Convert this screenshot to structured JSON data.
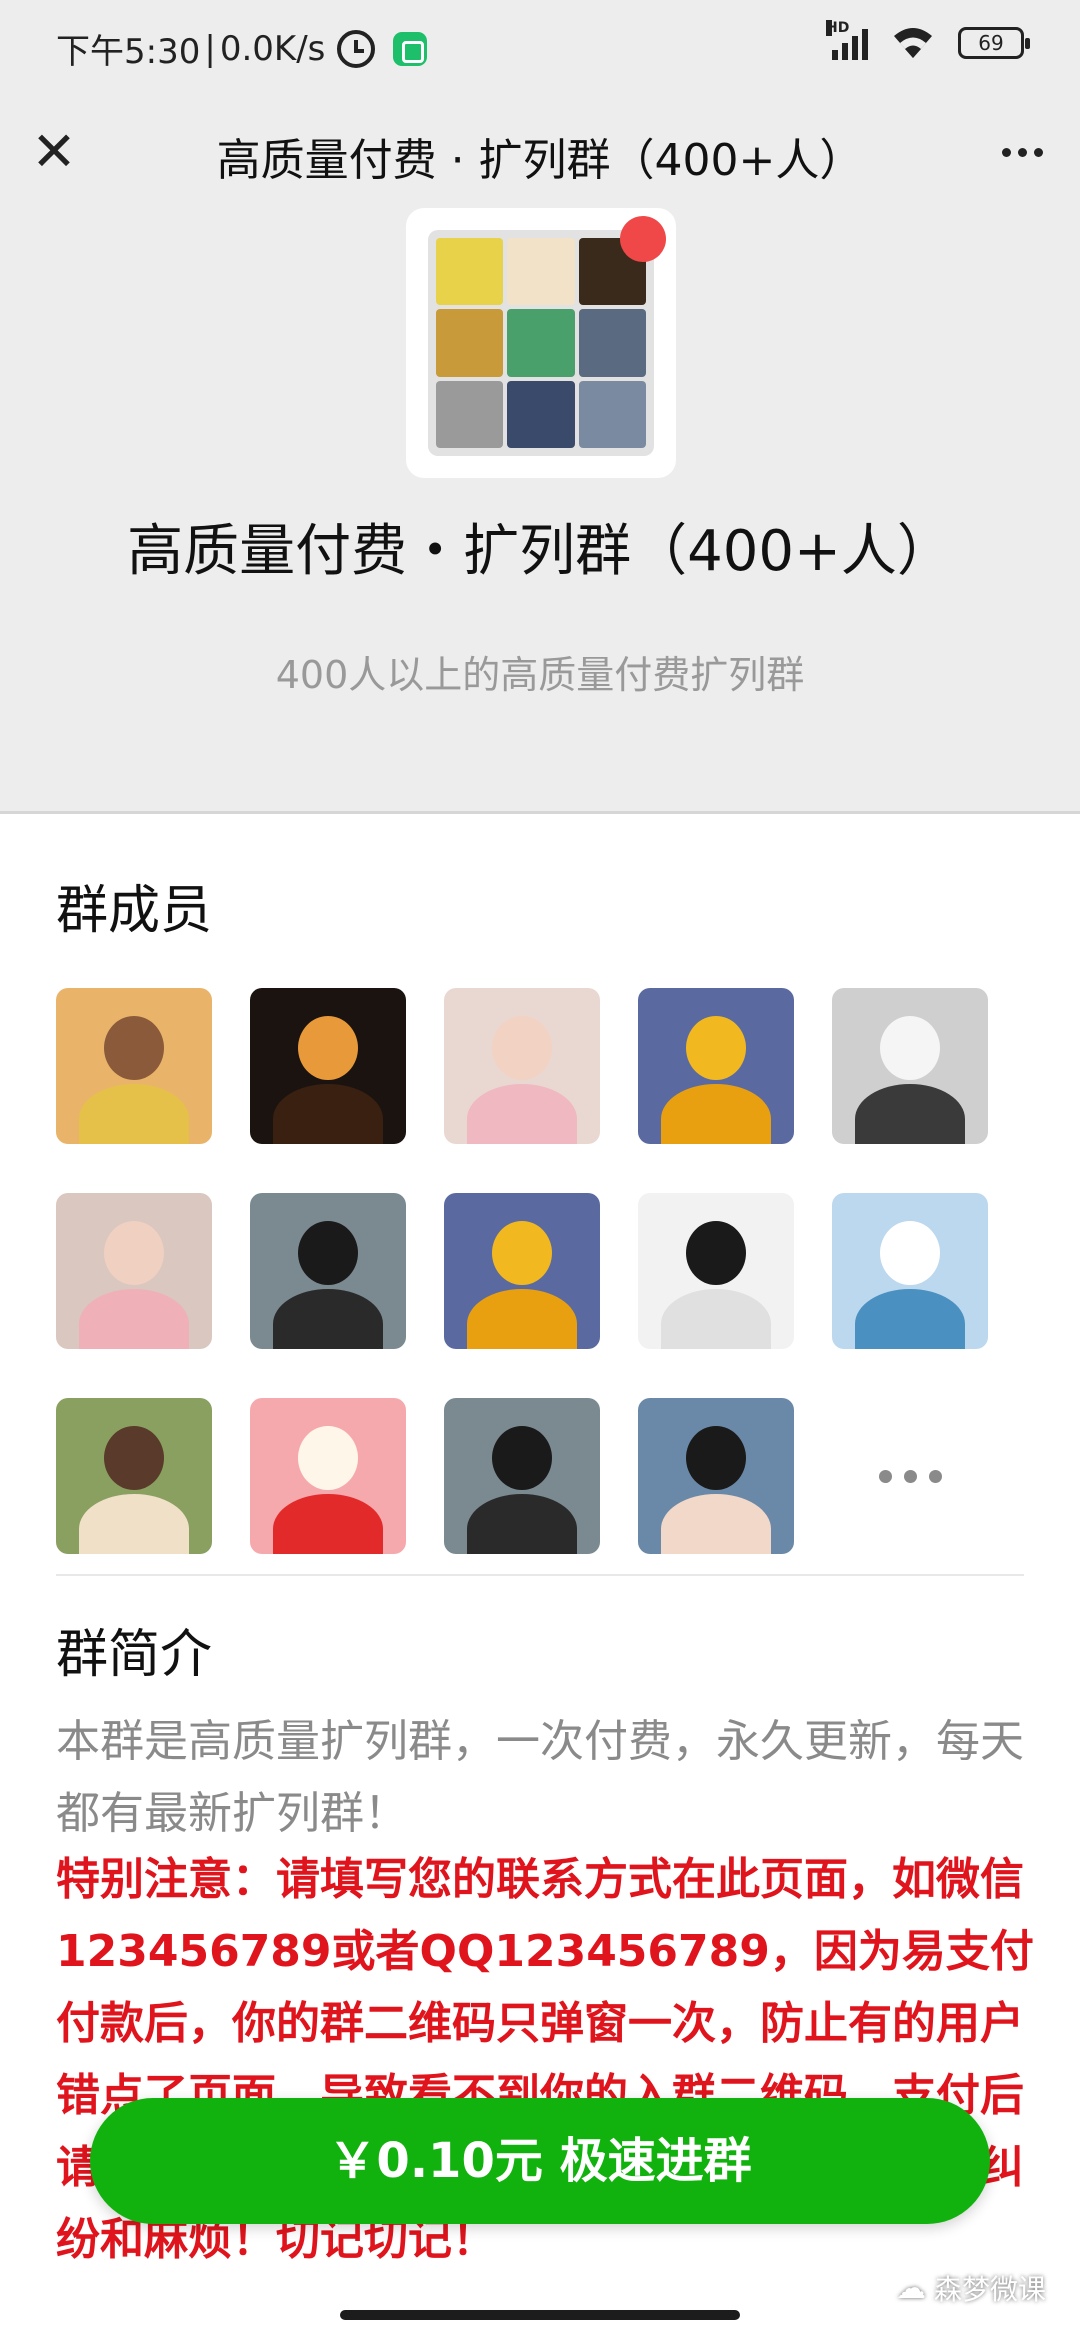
{
  "status_bar": {
    "time": "下午5:30",
    "separator": "|",
    "speed": "0.0K/s",
    "signal_label": "HD",
    "battery": "69"
  },
  "nav": {
    "title": "高质量付费 · 扩列群（400+人）",
    "close_icon": "close-icon",
    "more_icon": "more-icon"
  },
  "group": {
    "name": "高质量付费・扩列群（400+人）",
    "description": "400人以上的高质量付费扩列群",
    "avatar_colors": [
      "#e7d24a",
      "#f2e3c8",
      "#3a2a1c",
      "#c89a3a",
      "#4aa06a",
      "#5a6a80",
      "#9a9a9a",
      "#3a4a6a",
      "#7a8aa0"
    ]
  },
  "members": {
    "title": "群成员",
    "items": [
      {
        "name": "member-1",
        "bg": "#e9b46a",
        "head": "#8a5a3a",
        "body": "#e5c14a"
      },
      {
        "name": "member-2",
        "bg": "#1a1310",
        "head": "#e89a3a",
        "body": "#3a2010"
      },
      {
        "name": "member-3",
        "bg": "#e9d8d2",
        "head": "#f2d2c2",
        "body": "#f0b8c0"
      },
      {
        "name": "member-4",
        "bg": "#5a6aa0",
        "head": "#f2b820",
        "body": "#e8a010"
      },
      {
        "name": "member-5",
        "bg": "#cfcfcf",
        "head": "#f5f5f5",
        "body": "#3a3a3a"
      },
      {
        "name": "member-6",
        "bg": "#d9c7c0",
        "head": "#f0d0c0",
        "body": "#f0b0b8"
      },
      {
        "name": "member-7",
        "bg": "#7a8a90",
        "head": "#1a1a1a",
        "body": "#2a2a2a"
      },
      {
        "name": "member-8",
        "bg": "#5a6aa0",
        "head": "#f2b820",
        "body": "#e8a010"
      },
      {
        "name": "member-9",
        "bg": "#f2f2f2",
        "head": "#1a1a1a",
        "body": "#e0e0e0"
      },
      {
        "name": "member-10",
        "bg": "#bcd8ee",
        "head": "#ffffff",
        "body": "#4a90c0"
      },
      {
        "name": "member-11",
        "bg": "#8aa060",
        "head": "#5a3a2a",
        "body": "#f0e0c8"
      },
      {
        "name": "member-12",
        "bg": "#f6a9ad",
        "head": "#fff6ea",
        "body": "#e22a2a"
      },
      {
        "name": "member-13",
        "bg": "#7a8a90",
        "head": "#1a1a1a",
        "body": "#2a2a2a"
      },
      {
        "name": "member-14",
        "bg": "#6a88a8",
        "head": "#1a1a1a",
        "body": "#f2d8c8"
      }
    ],
    "more_icon": "more-dots-icon"
  },
  "intro": {
    "title": "群简介",
    "text": "本群是高质量扩列群，一次付费，永久更新，每天都有最新扩列群！",
    "notice": "特别注意：请填写您的联系方式在此页面，如微信123456789或者QQ123456789，因为易支付付款后，你的群二维码只弹窗一次，防止有的用户错点了页面，导致看不到你的入群二维码，支付后请截图保存好，请及时联系官方，产生不必要的纠纷和麻烦！切记切记！"
  },
  "join_button": {
    "label": "￥0.10元 极速进群",
    "color": "#12b20e"
  },
  "watermark": {
    "text": "森梦微课"
  }
}
